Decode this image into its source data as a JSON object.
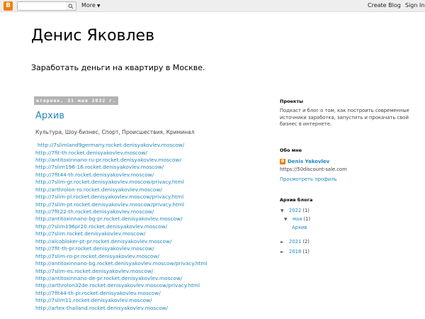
{
  "navbar": {
    "logo_letter": "B",
    "more_label": "More",
    "create_blog": "Create Blog",
    "sign_in": "Sign In"
  },
  "header": {
    "title": "Денис Яковлев",
    "description": "Заработать деньги на квартиру в Москве."
  },
  "post": {
    "date": "вторник, 31 мая 2022 г.",
    "title": "Архив",
    "categories": "Культура, Шоу-бизнес, Спорт, Происшествия, Криминал",
    "links": [
      "http://7slimland9germany.rocket.denisyakovlev.moscow/",
      "http://7fit-th.rocket.denisyakovlev.moscow/",
      "http://antitoxinnano-ru-pr.rocket.denisyakovlev.moscow/",
      "http://7slim196-16.rocket.denisyakovlev.moscow/",
      "http://7fit44-th.rocket.denisyakovlev.moscow/",
      "http://7slim-gr.rocket.denisyakovlev.moscow/privacy.html",
      "http://arthrolon-ro.rocket.denisyakovlev.moscow/",
      "http://7slim-pl.rocket.denisyakovlev.moscow/privacy.html",
      "http://7slim-pt.rocket.denisyakovlev.moscow/privacy.html",
      "http://7fit22-th.rocket.denisyakovlev.moscow/",
      "http://antitoxinnano-bg-pr.rocket.denisyakovlev.moscow/",
      "http://7slim196pr20.rocket.denisyakovlev.moscow/",
      "http://7slim.rocket.denisyakovlev.moscow/",
      "http://alcobloker-pt-pr.rocket.denisyakovlev.moscow/",
      "http://7fit-th-pr.rocket.denisyakovlev.moscow/",
      "http://7slim-ro-pr.rocket.denisyakovlev.moscow/",
      "http://antitoxinnano-bg.rocket.denisyakovlev.moscow/privacy.html",
      "http://7slim-es.rocket.denisyakovlev.moscow/",
      "http://antitoxinnano-de-pr.rocket.denisyakovlev.moscow/",
      "http://arthrolon32de.rocket.denisyakovlev.moscow/privacy.html",
      "http://7fit44-th-pr.rocket.denisyakovlev.moscow/",
      "http://7slim11.rocket.denisyakovlev.moscow/",
      "http://artex-thailand.rocket.denisyakovlev.moscow/"
    ]
  },
  "sidebar": {
    "projects_title": "Проекты",
    "projects_text": "Подкаст и блог о том, как построить современные источники заработка, запустить и прокачать свой бизнес в интернете.",
    "about_title": "Обо мне",
    "profile_icon_letter": "B",
    "profile_name": "Denis Yakovlev",
    "profile_site": "https://50discount-sale.com",
    "view_profile": "Просмотреть профиль",
    "archive_title": "Архив блога",
    "archive": {
      "y2022": {
        "year": "2022",
        "count": "(1)"
      },
      "may": {
        "month": "мая",
        "count": "(1)"
      },
      "post": "Архив",
      "y2021": {
        "year": "2021",
        "count": "(2)"
      },
      "y2018": {
        "year": "2018",
        "count": "(1)"
      }
    }
  }
}
